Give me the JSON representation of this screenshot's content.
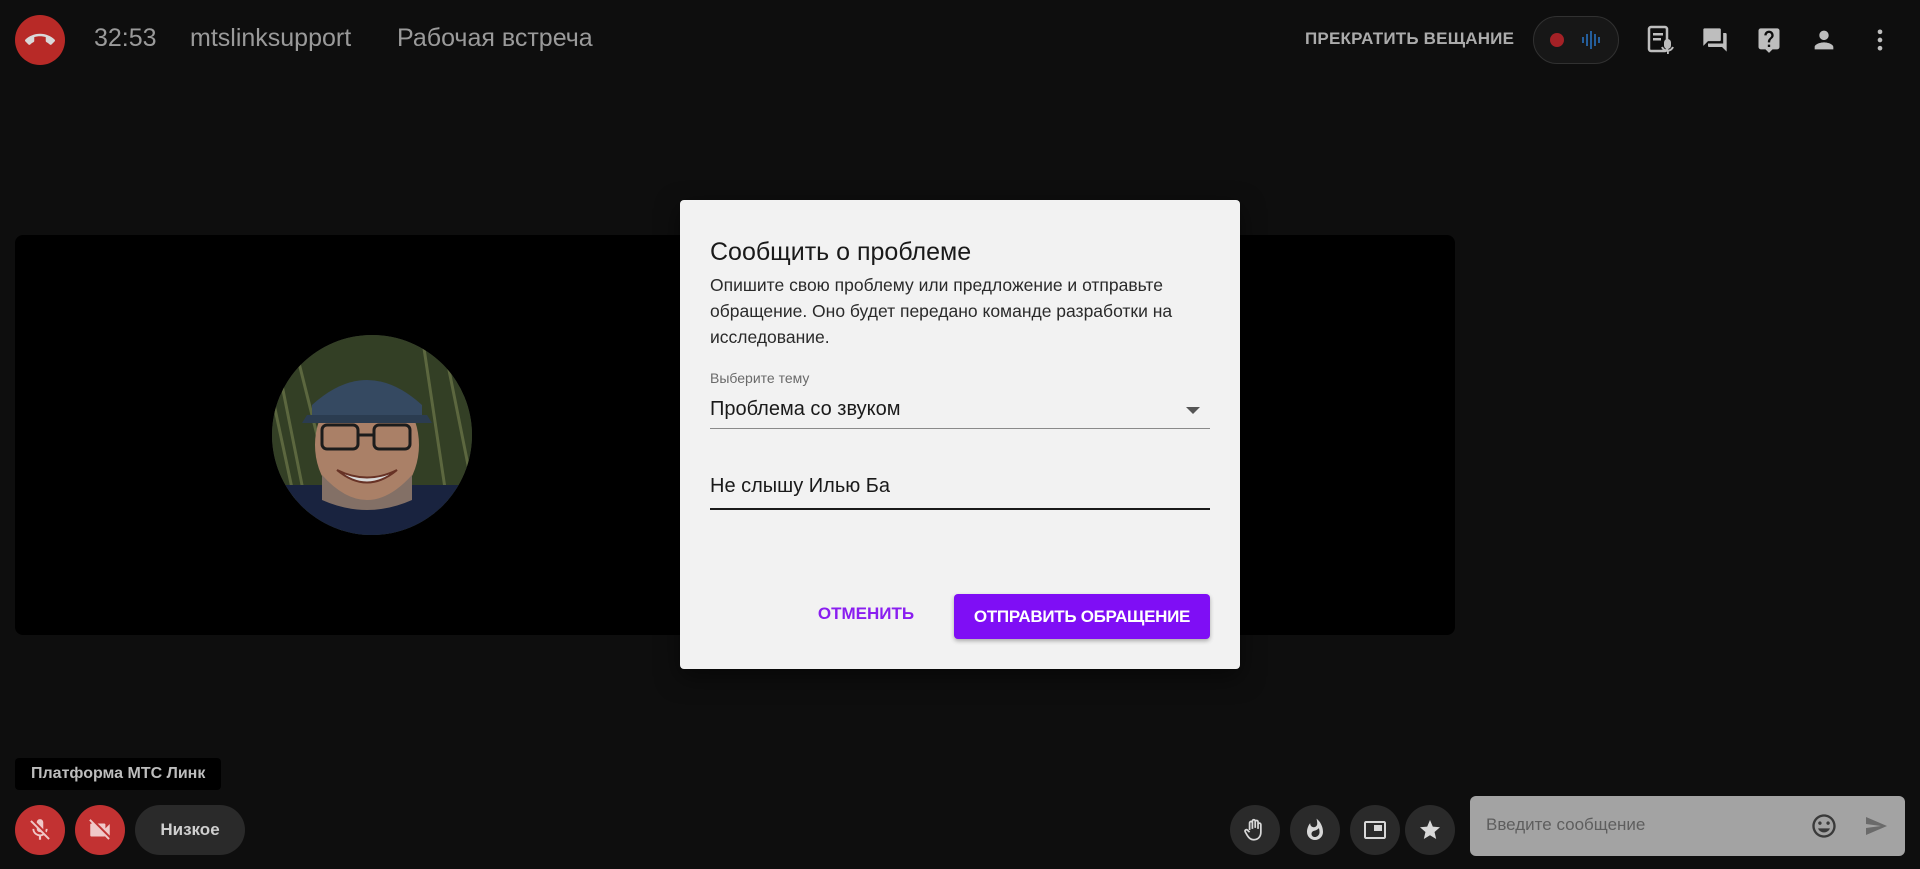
{
  "header": {
    "timer": "32:53",
    "account": "mtslinksupport",
    "meeting_title": "Рабочая встреча",
    "stop_broadcast_label": "ПРЕКРАТИТЬ ВЕЩАНИЕ"
  },
  "dialog": {
    "title": "Сообщить о проблеме",
    "description": "Опишите свою проблему или предложение и отправьте обращение. Оно будет передано команде разработки на исследование.",
    "topic_label": "Выберите тему",
    "topic_value": "Проблема со звуком",
    "message_value": "Не слышу Илью Ба",
    "cancel_label": "ОТМЕНИТЬ",
    "submit_label": "ОТПРАВИТЬ ОБРАЩЕНИЕ"
  },
  "bottom": {
    "platform_label": "Платформа МТС Линк",
    "quality_label": "Низкое",
    "chat_placeholder": "Введите сообщение"
  },
  "colors": {
    "accent": "#7f0ef5",
    "danger": "#d9322e",
    "background": "#111111"
  },
  "icons": [
    "phone-hangup-icon",
    "record-icon",
    "audio-wave-icon",
    "transcript-icon",
    "chat-icon",
    "help-icon",
    "person-icon",
    "more-vert-icon",
    "mic-off-icon",
    "camera-off-icon",
    "raise-hand-icon",
    "fire-icon",
    "picture-in-picture-icon",
    "star-icon",
    "emoji-icon",
    "send-icon"
  ]
}
